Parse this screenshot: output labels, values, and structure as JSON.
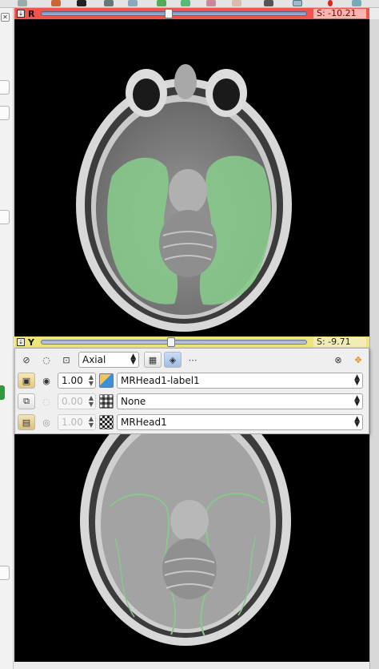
{
  "red_view": {
    "pin_glyph": "⇣",
    "label": "R",
    "slider_fraction": 0.48,
    "offset_text": "S: -10.21",
    "color": "#f2534b"
  },
  "yellow_view": {
    "pin_glyph": "⇣",
    "label": "Y",
    "slider_fraction": 0.49,
    "offset_text": "S: -9.71",
    "color": "#ede47a"
  },
  "left_panel": {
    "close_glyph": "✕"
  },
  "controller": {
    "orientation": "Axial",
    "icons": [
      "link-icon",
      "eye-outline-icon",
      "fit-to-window-icon",
      "layout-icon",
      "slice-model-icon",
      "more-icon",
      "link-toggle-icon",
      "crosshair-icon"
    ],
    "layers": [
      {
        "name": "label",
        "opacity": "1.00",
        "volume": "MRHead1-label1",
        "enabled": true
      },
      {
        "name": "foreground",
        "opacity": "0.00",
        "volume": "None",
        "enabled": false
      },
      {
        "name": "background",
        "opacity": "1.00",
        "volume": "MRHead1",
        "enabled": false
      }
    ]
  },
  "overlay_color": "#86c98a",
  "ui_colors": {
    "accent_blue": "#3e8fd6",
    "bar_blue": "#7d8fb8"
  }
}
